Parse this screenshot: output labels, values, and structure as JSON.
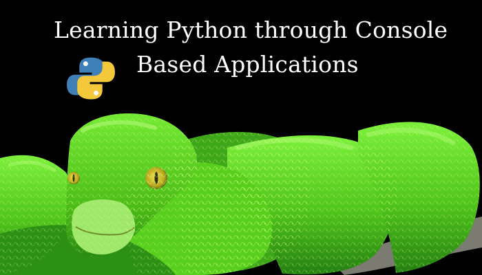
{
  "banner": {
    "title_line_1": "Learning Python through Console",
    "title_line_2": "Based Applications"
  },
  "colors": {
    "background": "#000000",
    "title_text": "#ffffff",
    "python_logo_blue": "#3f7fb8",
    "python_logo_yellow": "#f3c93b",
    "snake_green": "#5fd11e",
    "snake_dark_green": "#228b11",
    "snake_eye": "#d5c12a",
    "branch_gray": "#8a8a82"
  },
  "icons": {
    "logo": "python-logo-icon"
  }
}
